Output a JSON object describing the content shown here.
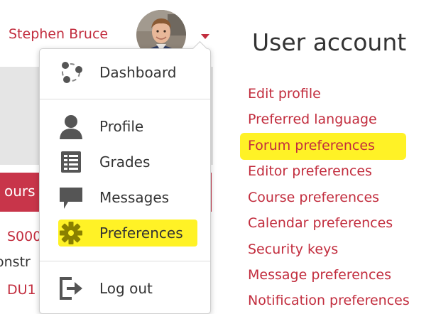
{
  "user_menu": {
    "user_name": "Stephen Bruce",
    "items": [
      {
        "label": "Dashboard",
        "icon": "dashboard-icon"
      },
      {
        "label": "Profile",
        "icon": "user-icon"
      },
      {
        "label": "Grades",
        "icon": "grades-icon"
      },
      {
        "label": "Messages",
        "icon": "message-icon"
      },
      {
        "label": "Preferences",
        "icon": "gear-icon",
        "highlighted": true
      },
      {
        "label": "Log out",
        "icon": "logout-icon"
      }
    ]
  },
  "background_page": {
    "tab_fragment": "ours",
    "course_fragments": [
      "S000",
      "onstr",
      "DU1"
    ]
  },
  "user_account": {
    "title": "User account",
    "links": [
      {
        "label": "Edit profile"
      },
      {
        "label": "Preferred language"
      },
      {
        "label": "Forum preferences",
        "highlighted": true
      },
      {
        "label": "Editor preferences"
      },
      {
        "label": "Course preferences"
      },
      {
        "label": "Calendar preferences"
      },
      {
        "label": "Security keys"
      },
      {
        "label": "Message preferences"
      },
      {
        "label": "Notification preferences"
      }
    ]
  },
  "colors": {
    "link": "#c22d3e",
    "highlight": "#fff226",
    "text": "#333333",
    "icon": "#555555",
    "gear_icon": "#8a8000"
  }
}
